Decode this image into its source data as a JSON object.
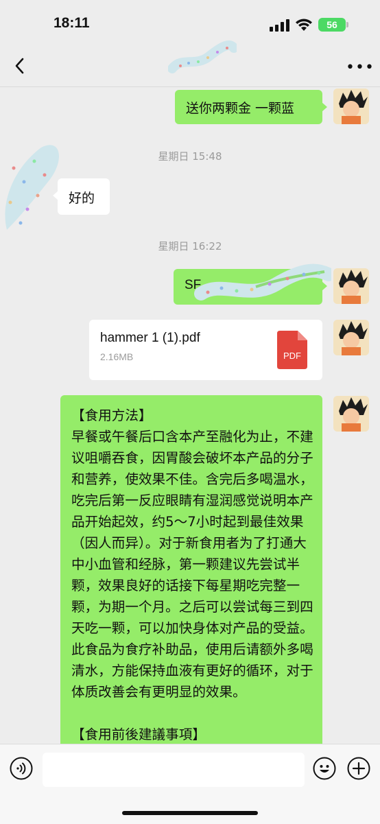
{
  "status": {
    "time": "18:11",
    "battery": "56"
  },
  "nav": {
    "back_icon": "chevron-left-icon",
    "more_label": "•••"
  },
  "messages": {
    "m1": "送你两颗金 一颗蓝",
    "ts1": "星期日 15:48",
    "m2": "好的",
    "ts2": "星期日 16:22",
    "m3_prefix": "SF",
    "file": {
      "name": "hammer 1 (1).pdf",
      "size": "2.16MB",
      "badge": "PDF"
    },
    "long_text": "【食用方法】\n早餐或午餐后口含本产至融化为止，不建议咀嚼吞食，因胃酸会破坏本产品的分子和营养，使效果不佳。含完后多喝温水，吃完后第一反应眼睛有湿润感觉说明本产品开始起效，约5～7小时起到最佳效果（因人而异）。对于新食用者为了打通大中小血管和经脉，第一颗建议先尝试半颗，效果良好的话接下每星期吃完整一颗，为期一个月。之后可以尝试每三到四天吃一颗，可以加快身体对产品的受益。此食品为食疗补助品，使用后请额外多喝清水，方能保持血液有更好的循环，对于体质改善会有更明显的效果。\n\n【食用前後建議事項】"
  },
  "colors": {
    "me_bubble": "#95ec69",
    "other_bubble": "#ffffff",
    "bg": "#ededed",
    "pdf_red": "#e2453c"
  }
}
